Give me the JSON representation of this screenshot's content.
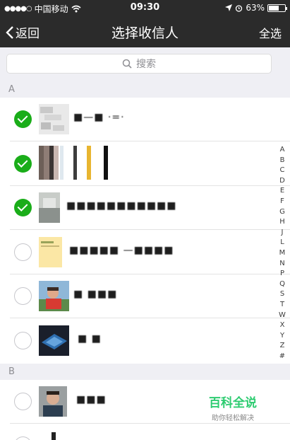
{
  "status_bar": {
    "signal_dots": "●●●●○",
    "carrier": "中国移动",
    "wifi_icon": "wifi-icon",
    "time": "09:30",
    "location_icon": "location-arrow-icon",
    "alarm_icon": "alarm-icon",
    "battery_percent": "63%",
    "battery_level": 0.63
  },
  "nav": {
    "back_label": "返回",
    "title": "选择收信人",
    "select_all_label": "全选"
  },
  "search": {
    "placeholder": "搜索"
  },
  "sections": [
    {
      "letter": "A"
    },
    {
      "letter": "B"
    }
  ],
  "contacts": [
    {
      "name": "■—■ ·=·",
      "checked": true
    },
    {
      "name": "",
      "checked": true
    },
    {
      "name": "■■■■■■■■■■■",
      "checked": true
    },
    {
      "name": "■■■■■ —■■■■",
      "checked": false
    },
    {
      "name": "■ ■■■",
      "checked": false
    },
    {
      "name": "■ ■",
      "checked": false
    },
    {
      "name": "■■■",
      "checked": false
    }
  ],
  "index_letters": [
    "A",
    "B",
    "C",
    "D",
    "E",
    "F",
    "G",
    "H",
    "J",
    "L",
    "M",
    "N",
    "P",
    "Q",
    "S",
    "T",
    "W",
    "X",
    "Y",
    "Z",
    "#"
  ],
  "watermark": {
    "title": "百科全说",
    "subtitle": "助你轻松解决"
  },
  "colors": {
    "nav_bg": "#2b2b2b",
    "check_green": "#1aad19",
    "watermark_green": "#2ecc71"
  }
}
